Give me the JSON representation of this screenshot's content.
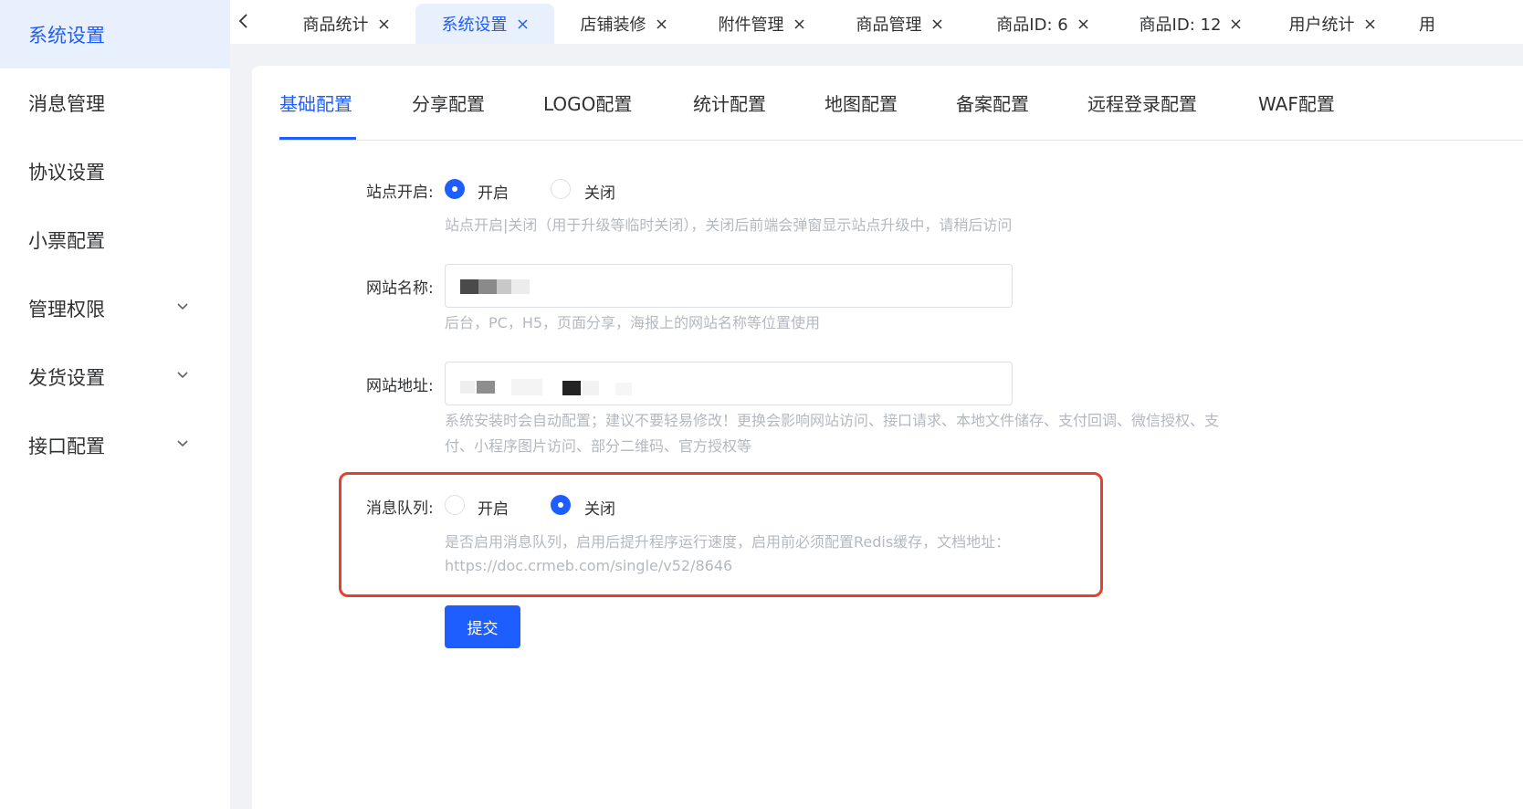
{
  "sidebar": {
    "items": [
      {
        "label": "系统设置"
      },
      {
        "label": "消息管理"
      },
      {
        "label": "协议设置"
      },
      {
        "label": "小票配置"
      },
      {
        "label": "管理权限"
      },
      {
        "label": "发货设置"
      },
      {
        "label": "接口配置"
      }
    ]
  },
  "tabs": [
    {
      "label": "商品统计"
    },
    {
      "label": "系统设置"
    },
    {
      "label": "店铺装修"
    },
    {
      "label": "附件管理"
    },
    {
      "label": "商品管理"
    },
    {
      "label": "商品ID: 6"
    },
    {
      "label": "商品ID: 12"
    },
    {
      "label": "用户统计"
    },
    {
      "label": "用"
    }
  ],
  "subtabs": [
    {
      "label": "基础配置"
    },
    {
      "label": "分享配置"
    },
    {
      "label": "LOGO配置"
    },
    {
      "label": "统计配置"
    },
    {
      "label": "地图配置"
    },
    {
      "label": "备案配置"
    },
    {
      "label": "远程登录配置"
    },
    {
      "label": "WAF配置"
    }
  ],
  "form": {
    "site_open": {
      "label": "站点开启:",
      "option_on": "开启",
      "option_off": "关闭",
      "selected": "开启",
      "hint": "站点开启|关闭（用于升级等临时关闭），关闭后前端会弹窗显示站点升级中，请稍后访问"
    },
    "site_name": {
      "label": "网站名称:",
      "hint": "后台，PC，H5，页面分享，海报上的网站名称等位置使用"
    },
    "site_url": {
      "label": "网站地址:",
      "hint_line1": "系统安装时会自动配置；建议不要轻易修改！更换会影响网站访问、接口请求、本地文件储存、支付回调、微信授权、支",
      "hint_line2": "付、小程序图片访问、部分二维码、官方授权等"
    },
    "message_queue": {
      "label": "消息队列:",
      "option_on": "开启",
      "option_off": "关闭",
      "selected": "关闭",
      "hint_line1": "是否启用消息队列，启用后提升程序运行速度，启用前必须配置Redis缓存，文档地址：",
      "hint_line2": "https://doc.crmeb.com/single/v52/8646"
    },
    "submit_label": "提交"
  },
  "colors": {
    "primary": "#1e5eff",
    "active_bg": "#e8f0fe",
    "highlight_border": "#e53f2e",
    "hint_text": "#b4b8bf"
  }
}
